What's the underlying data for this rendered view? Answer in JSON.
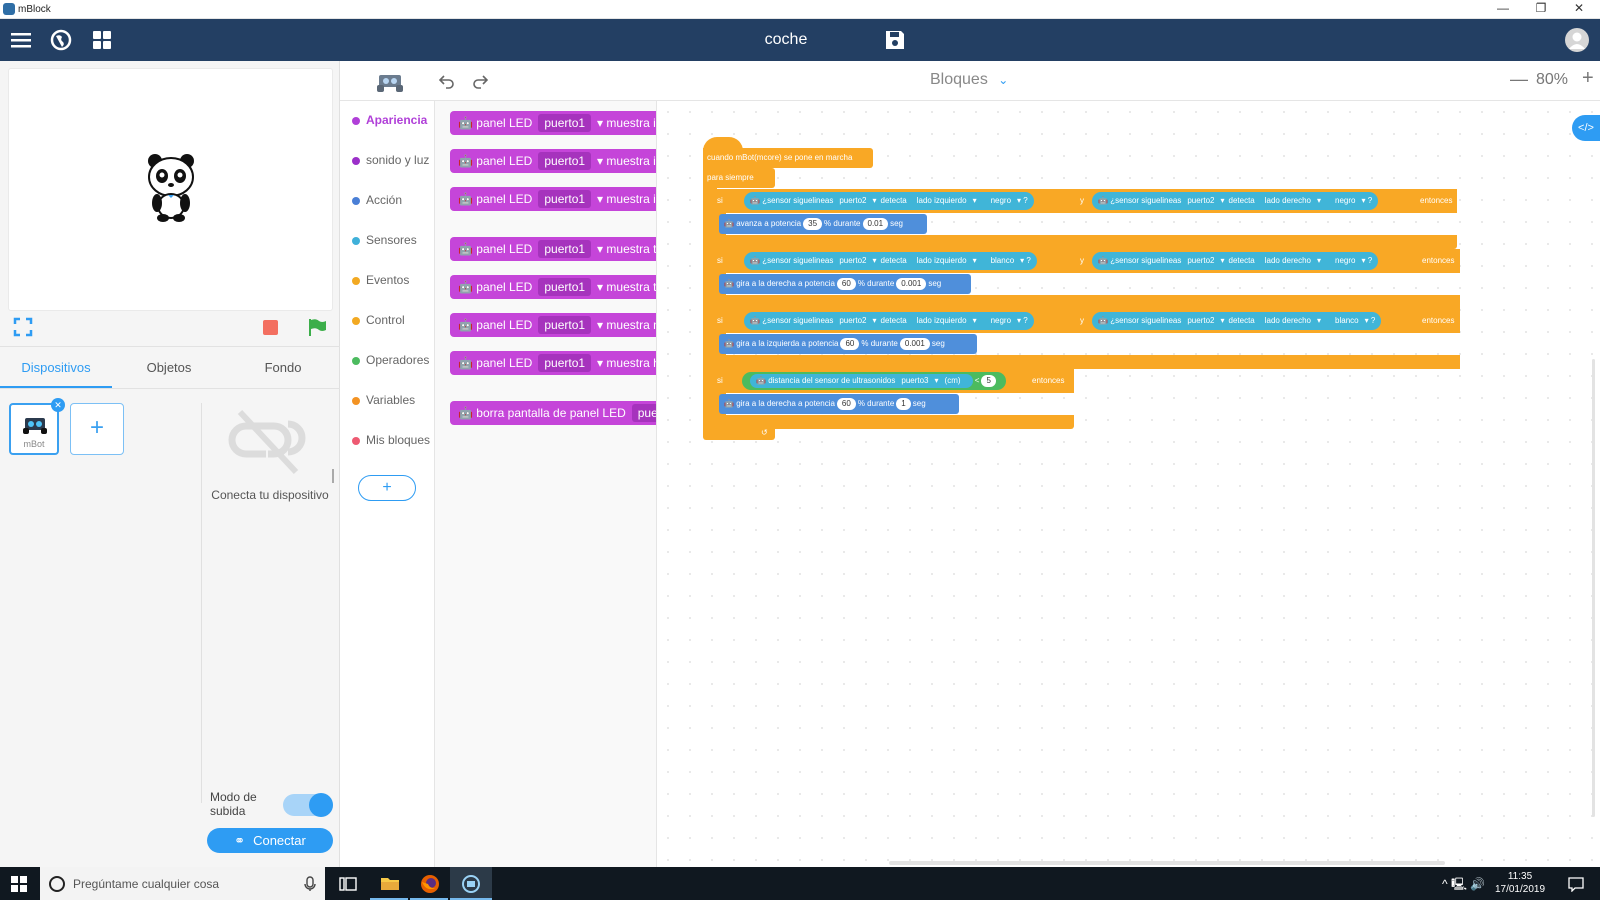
{
  "window": {
    "title": "mBlock",
    "minimize": "—",
    "restore": "❐",
    "close": "✕"
  },
  "header": {
    "project_title": "coche"
  },
  "stage": {},
  "tabs": [
    {
      "label": "Dispositivos"
    },
    {
      "label": "Objetos"
    },
    {
      "label": "Fondo"
    }
  ],
  "devices": {
    "device_label": "mBot",
    "connect_hint": "Conecta tu dispositivo",
    "upload_mode_label": "Modo de subida",
    "connect_button": "Conectar"
  },
  "editor": {
    "mode_label": "Bloques",
    "zoom": "80%",
    "zoom_minus": "—",
    "zoom_plus": "+"
  },
  "categories": [
    {
      "label": "Apariencia",
      "color": "#b03fd8"
    },
    {
      "label": "sonido y luz",
      "color": "#9b2fc9"
    },
    {
      "label": "Acción",
      "color": "#4a7fd6"
    },
    {
      "label": "Sensores",
      "color": "#3fb0d9"
    },
    {
      "label": "Eventos",
      "color": "#f2a922"
    },
    {
      "label": "Control",
      "color": "#f2a922"
    },
    {
      "label": "Operadores",
      "color": "#4cbb5f"
    },
    {
      "label": "Variables",
      "color": "#f39323"
    },
    {
      "label": "Mis bloques",
      "color": "#ee5a72"
    }
  ],
  "palette": [
    {
      "label": "panel LED",
      "port": "puerto1",
      "action": "muestra ima"
    },
    {
      "label": "panel LED",
      "port": "puerto1",
      "action": "muestra ima"
    },
    {
      "label": "panel LED",
      "port": "puerto1",
      "action": "muestra ima"
    },
    {
      "label": "panel LED",
      "port": "puerto1",
      "action": "muestra tex"
    },
    {
      "label": "panel LED",
      "port": "puerto1",
      "action": "muestra tex"
    },
    {
      "label": "panel LED",
      "port": "puerto1",
      "action": "muestra núr"
    },
    {
      "label": "panel LED",
      "port": "puerto1",
      "action": "muestra hor"
    },
    {
      "label": "borra pantalla de panel LED",
      "port": "puerto",
      "action": ""
    }
  ],
  "script": {
    "hat": "cuando mBot(mcore) se pone en marcha",
    "forever": "para siempre",
    "if_label": "si",
    "then_label": "entonces",
    "and_label": "y",
    "question": "?",
    "sensor": "¿sensor siguelineas",
    "detects": "detecta",
    "if1": {
      "left": {
        "port": "puerto2",
        "side": "lado izquierdo",
        "color": "negro"
      },
      "right": {
        "port": "puerto2",
        "side": "lado derecho",
        "color": "negro"
      },
      "action": {
        "text": "avanza a potencia",
        "power": "35",
        "mid": "% durante",
        "time": "0.01",
        "unit": "seg"
      }
    },
    "if2": {
      "left": {
        "port": "puerto2",
        "side": "lado izquierdo",
        "color": "blanco"
      },
      "right": {
        "port": "puerto2",
        "side": "lado derecho",
        "color": "negro"
      },
      "action": {
        "text": "gira a la derecha a potencia",
        "power": "60",
        "mid": "% durante",
        "time": "0.001",
        "unit": "seg"
      }
    },
    "if3": {
      "left": {
        "port": "puerto2",
        "side": "lado izquierdo",
        "color": "negro"
      },
      "right": {
        "port": "puerto2",
        "side": "lado derecho",
        "color": "blanco"
      },
      "action": {
        "text": "gira a la izquierda a potencia",
        "power": "60",
        "mid": "% durante",
        "time": "0.001",
        "unit": "seg"
      }
    },
    "if4": {
      "cond_text": "distancia del sensor de ultrasonidos",
      "port": "puerto3",
      "unit": "(cm)",
      "op": "<",
      "value": "5",
      "action": {
        "text": "gira a la derecha a potencia",
        "power": "60",
        "mid": "% durante",
        "time": "1",
        "unit": "seg"
      }
    }
  },
  "taskbar": {
    "search_placeholder": "Pregúntame cualquier cosa",
    "time": "11:35",
    "date": "17/01/2019"
  }
}
